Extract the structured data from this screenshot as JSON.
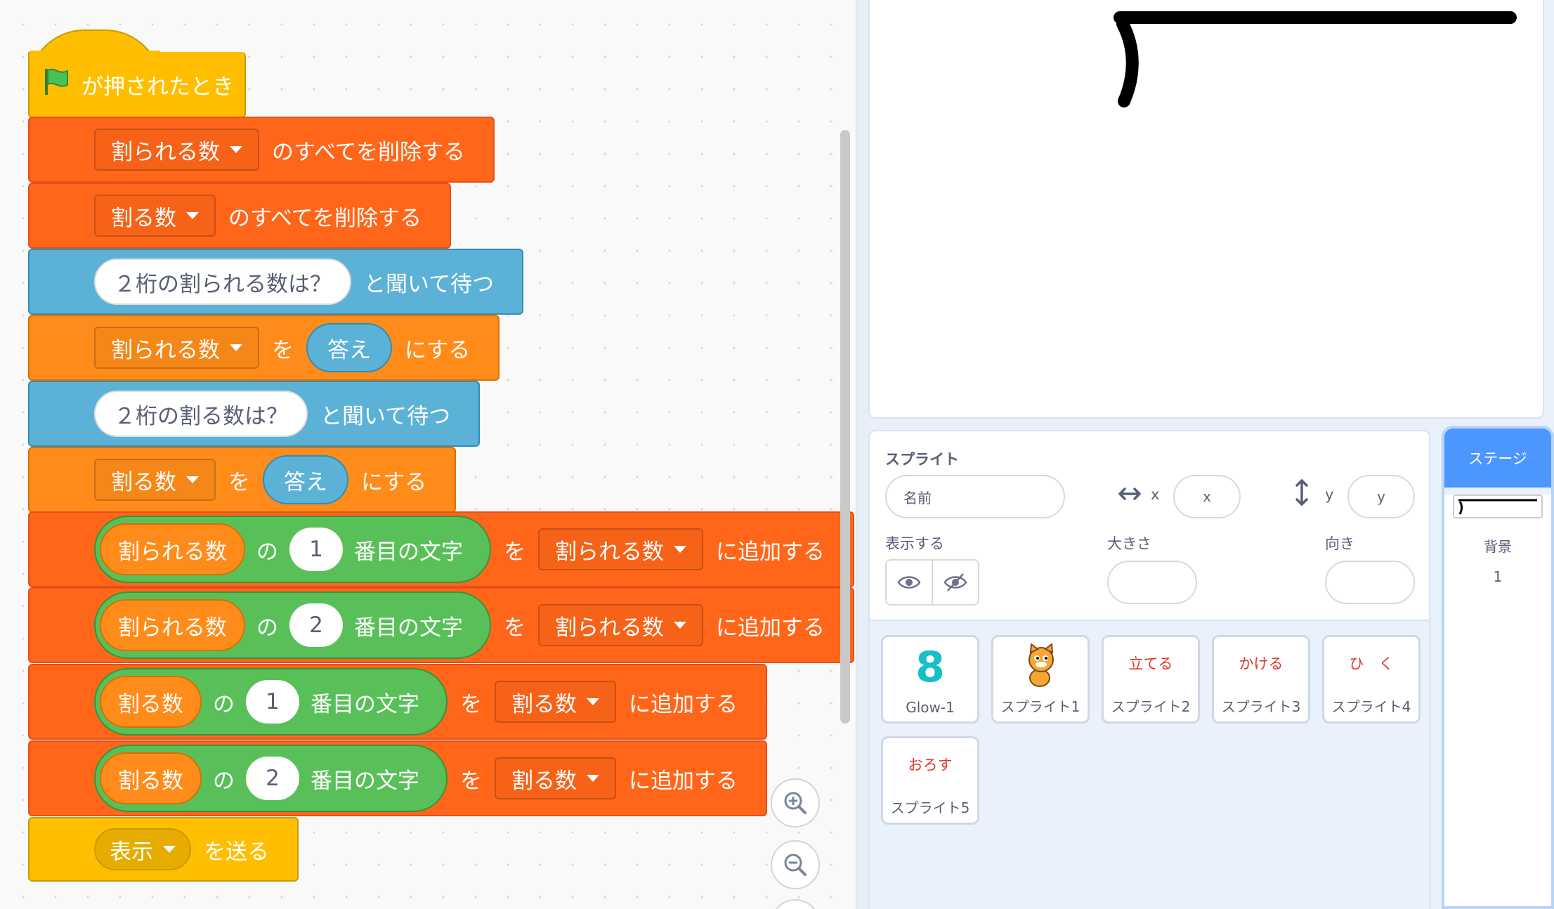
{
  "code": {
    "hat_label": "が押されたとき",
    "blocks": [
      {
        "dd": "割られる数",
        "text": "のすべてを削除する"
      },
      {
        "dd": "割る数",
        "text": "のすべてを削除する"
      },
      {
        "question": "２桁の割られる数は？",
        "text": "と聞いて待つ"
      },
      {
        "dd": "割られる数",
        "wo": "を",
        "reporter": "答え",
        "text": "にする"
      },
      {
        "question": "２桁の割る数は？",
        "text": "と聞いて待つ"
      },
      {
        "dd": "割る数",
        "wo": "を",
        "reporter": "答え",
        "text": "にする"
      },
      {
        "var": "割られる数",
        "no": "の",
        "index": "1",
        "letter": "番目の文字",
        "wo": "を",
        "dd": "割られる数",
        "text": "に追加する"
      },
      {
        "var": "割られる数",
        "no": "の",
        "index": "2",
        "letter": "番目の文字",
        "wo": "を",
        "dd": "割られる数",
        "text": "に追加する"
      },
      {
        "var": "割る数",
        "no": "の",
        "index": "1",
        "letter": "番目の文字",
        "wo": "を",
        "dd": "割る数",
        "text": "に追加する"
      },
      {
        "var": "割る数",
        "no": "の",
        "index": "2",
        "letter": "番目の文字",
        "wo": "を",
        "dd": "割る数",
        "text": "に追加する"
      },
      {
        "dd": "表示",
        "text": "を送る"
      }
    ]
  },
  "sprite_info": {
    "title": "スプライト",
    "name_placeholder": "名前",
    "x_label": "x",
    "x_placeholder": "x",
    "y_label": "y",
    "y_placeholder": "y",
    "show_label": "表示する",
    "size_label": "大きさ",
    "direction_label": "向き"
  },
  "sprites": [
    {
      "name": "Glow-1",
      "costume": "8"
    },
    {
      "name": "スプライト1",
      "costume": ""
    },
    {
      "name": "スプライト2",
      "costume": "立てる"
    },
    {
      "name": "スプライト3",
      "costume": "かける"
    },
    {
      "name": "スプライト4",
      "costume": "ひ　く"
    },
    {
      "name": "スプライト5",
      "costume": "おろす"
    }
  ],
  "stage_pane": {
    "title": "ステージ",
    "backdrop_label": "背景",
    "backdrop_count": "1"
  },
  "colors": {
    "motion_orange": "#ff661a",
    "variables": "#ff8c1a",
    "sensing": "#5cb1d6",
    "operators": "#59c059",
    "events": "#ffbf00",
    "accent": "#4c97ff"
  }
}
